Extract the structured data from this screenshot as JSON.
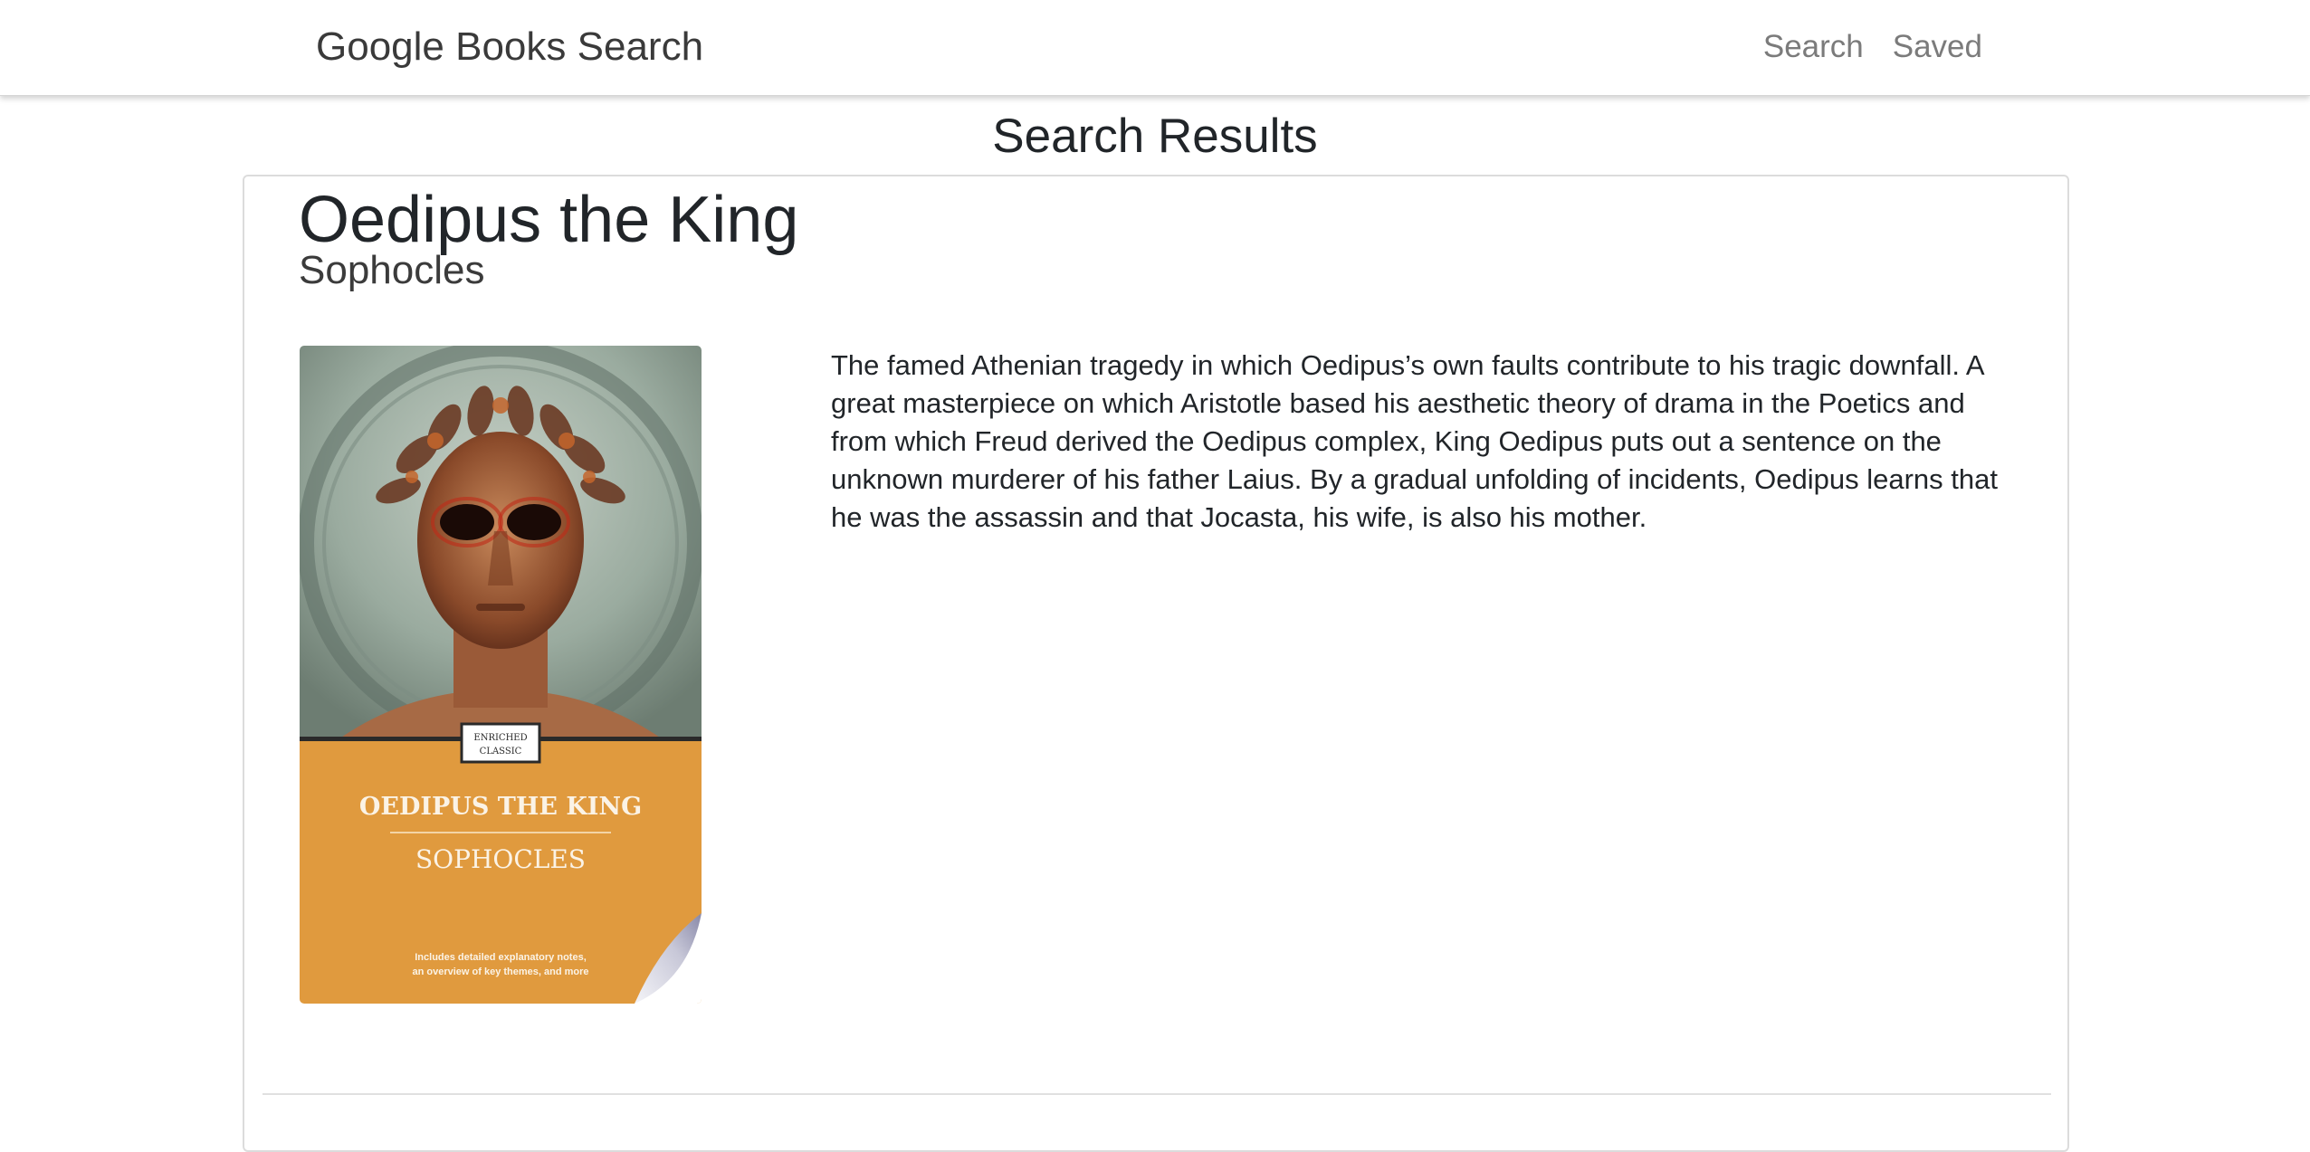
{
  "navbar": {
    "brand": "Google Books Search",
    "links": [
      {
        "label": "Search"
      },
      {
        "label": "Saved"
      }
    ]
  },
  "page": {
    "title": "Search Results"
  },
  "results": [
    {
      "title": "Oedipus the King",
      "author": "Sophocles",
      "description": "The famed Athenian tragedy in which Oedipus’s own faults contribute to his tragic downfall. A great masterpiece on which Aristotle based his aesthetic theory of drama in the Poetics and from which Freud derived the Oedipus complex, King Oedipus puts out a sentence on the unknown murderer of his father Laius. By a gradual unfolding of incidents, Oedipus learns that he was the assassin and that Jocasta, his wife, is also his mother.",
      "cover": {
        "badge_line1": "ENRICHED",
        "badge_line2": "CLASSIC",
        "title": "OEDIPUS THE KING",
        "author": "SOPHOCLES",
        "tagline_line1": "Includes detailed explanatory notes,",
        "tagline_line2": "an overview of key themes, and more",
        "colors": {
          "band": "#e09a3e",
          "background": "#9aab9f",
          "face": "#b0704a"
        }
      }
    }
  ]
}
